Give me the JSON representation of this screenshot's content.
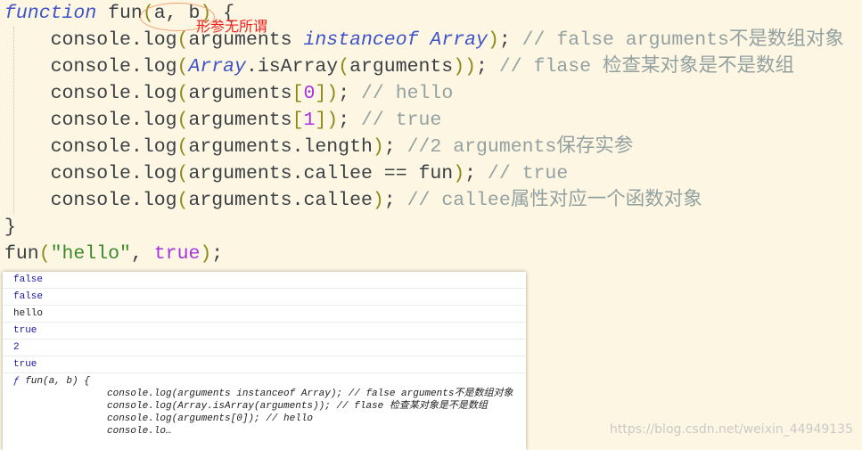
{
  "code_lines": [
    [
      [
        "kw",
        "function"
      ],
      [
        "plain",
        " fun"
      ],
      [
        "paren",
        "("
      ],
      [
        "plain",
        "a, b"
      ],
      [
        "paren",
        ")"
      ],
      [
        "plain",
        " {"
      ]
    ],
    [
      [
        "plain",
        "    console.log"
      ],
      [
        "paren",
        "("
      ],
      [
        "plain",
        "arguments "
      ],
      [
        "kw",
        "instanceof"
      ],
      [
        "plain",
        " "
      ],
      [
        "kw",
        "Array"
      ],
      [
        "paren",
        ")"
      ],
      [
        "plain",
        "; "
      ],
      [
        "cm",
        "// false arguments不是数组对象"
      ]
    ],
    [
      [
        "plain",
        "    console.log"
      ],
      [
        "paren",
        "("
      ],
      [
        "kw",
        "Array"
      ],
      [
        "plain",
        ".isArray"
      ],
      [
        "paren",
        "("
      ],
      [
        "plain",
        "arguments"
      ],
      [
        "paren",
        "))"
      ],
      [
        "plain",
        "; "
      ],
      [
        "cm",
        "// flase 检查某对象是不是数组"
      ]
    ],
    [
      [
        "plain",
        "    console.log"
      ],
      [
        "paren",
        "("
      ],
      [
        "plain",
        "arguments"
      ],
      [
        "paren",
        "["
      ],
      [
        "num",
        "0"
      ],
      [
        "paren",
        "])"
      ],
      [
        "plain",
        "; "
      ],
      [
        "cm",
        "// hello"
      ]
    ],
    [
      [
        "plain",
        "    console.log"
      ],
      [
        "paren",
        "("
      ],
      [
        "plain",
        "arguments"
      ],
      [
        "paren",
        "["
      ],
      [
        "num",
        "1"
      ],
      [
        "paren",
        "])"
      ],
      [
        "plain",
        "; "
      ],
      [
        "cm",
        "// true"
      ]
    ],
    [
      [
        "plain",
        "    console.log"
      ],
      [
        "paren",
        "("
      ],
      [
        "plain",
        "arguments.length"
      ],
      [
        "paren",
        ")"
      ],
      [
        "plain",
        "; "
      ],
      [
        "cm",
        "//2 arguments保存实参"
      ]
    ],
    [
      [
        "plain",
        "    console.log"
      ],
      [
        "paren",
        "("
      ],
      [
        "plain",
        "arguments.callee == fun"
      ],
      [
        "paren",
        ")"
      ],
      [
        "plain",
        "; "
      ],
      [
        "cm",
        "// true"
      ]
    ],
    [
      [
        "plain",
        "    console.log"
      ],
      [
        "paren",
        "("
      ],
      [
        "plain",
        "arguments.callee"
      ],
      [
        "paren",
        ")"
      ],
      [
        "plain",
        "; "
      ],
      [
        "cm",
        "// callee属性对应一个函数对象"
      ]
    ],
    [
      [
        "plain",
        "}"
      ]
    ],
    [
      [
        "plain",
        "fun"
      ],
      [
        "paren",
        "("
      ],
      [
        "str",
        "\"hello\""
      ],
      [
        "plain",
        ", "
      ],
      [
        "num",
        "true"
      ],
      [
        "paren",
        ")"
      ],
      [
        "plain",
        ";"
      ]
    ]
  ],
  "annotation": "形参无所谓",
  "console": {
    "rows": [
      {
        "text": "false",
        "type": "bool"
      },
      {
        "text": "false",
        "type": "bool"
      },
      {
        "text": "hello",
        "type": "str"
      },
      {
        "text": "true",
        "type": "bool"
      },
      {
        "text": "2",
        "type": "num"
      },
      {
        "text": "true",
        "type": "bool"
      }
    ],
    "fn_prefix": "ƒ",
    "fn_header": " fun(a, b) {",
    "fn_body": "console.log(arguments instanceof Array); // false arguments不是数组对象\nconsole.log(Array.isArray(arguments)); // flase 检查某对象是不是数组\nconsole.log(arguments[0]); // hello\nconsole.lo…"
  },
  "watermark": "https://blog.csdn.net/weixin_44949135"
}
